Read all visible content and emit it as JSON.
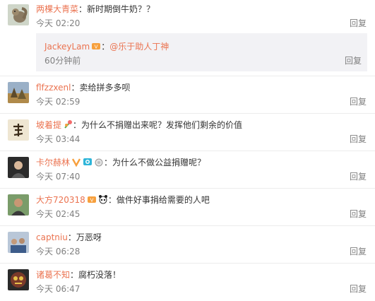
{
  "comments": [
    {
      "username": "两棵大青菜",
      "separator": "：",
      "text": "新时期倒牛奶？？",
      "time": "今天 02:20",
      "reply": "回复",
      "avatar_icon": "squirrel-avatar"
    },
    {
      "username": "flfzzxenl",
      "separator": "：",
      "text": "卖给拼多多呗",
      "time": "今天 02:59",
      "reply": "回复",
      "avatar_icon": "landscape-avatar"
    },
    {
      "username": "坡着提",
      "separator": "：",
      "text": "为什么不捐赠出来呢？发挥他们剩余的价值",
      "time": "今天 03:44",
      "reply": "回复",
      "avatar_icon": "calligraphy-avatar"
    },
    {
      "username": "卡尔赫林",
      "separator": "：",
      "text": "为什么不做公益捐赠呢？",
      "time": "今天 07:40",
      "reply": "回复",
      "avatar_icon": "portrait-avatar"
    },
    {
      "username": "大方720318",
      "separator": "：",
      "text": "做件好事捐给需要的人吧",
      "time": "今天 02:45",
      "reply": "回复",
      "avatar_icon": "man-avatar"
    },
    {
      "username": "captniu",
      "separator": "：",
      "text": "万恶呀",
      "time": "今天 06:28",
      "reply": "回复",
      "avatar_icon": "group-avatar"
    },
    {
      "username": "诸葛不知",
      "separator": "：",
      "text": "腐朽没落！",
      "time": "今天 06:47",
      "reply": "回复",
      "avatar_icon": "mask-avatar"
    }
  ],
  "sub_reply": {
    "username": "JackeyLam",
    "separator": "：",
    "mention": "@乐于助人丁神",
    "time": "60分钟前",
    "reply": "回复"
  },
  "colors": {
    "username": "#eb7350",
    "text": "#333333",
    "meta": "#808080",
    "subbox": "#f2f2f5"
  }
}
